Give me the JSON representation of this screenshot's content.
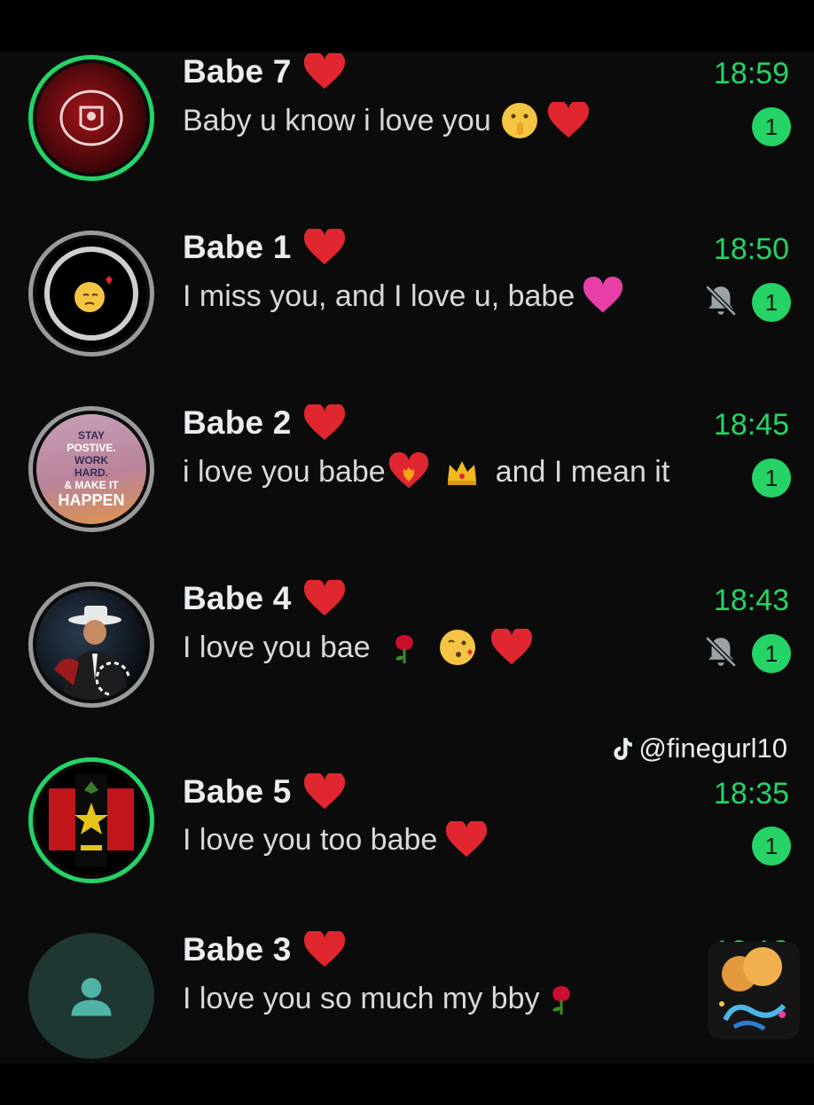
{
  "chats": [
    {
      "name": "Babe 7",
      "time": "18:59",
      "preview": "Baby u know i love you",
      "unread": "1",
      "muted": false
    },
    {
      "name": "Babe 1",
      "time": "18:50",
      "preview": "I miss you, and I love u, babe",
      "unread": "1",
      "muted": true
    },
    {
      "name": "Babe 2",
      "time": "18:45",
      "preview_a": "i love you babe",
      "preview_b": "and I mean it",
      "unread": "1",
      "muted": false,
      "avatar_text": [
        "STAY",
        "POSTIVE.",
        "WORK",
        "HARD.",
        "& MAKE IT",
        "HAPPEN"
      ]
    },
    {
      "name": "Babe 4",
      "time": "18:43",
      "preview": "I love you bae",
      "unread": "1",
      "muted": true
    },
    {
      "name": "Babe 5",
      "time": "18:35",
      "preview": "I love you too babe",
      "unread": "1",
      "muted": false
    },
    {
      "name": "Babe 3",
      "time": "18:18",
      "preview": "I love you so much my bby"
    }
  ],
  "watermark": {
    "handle": "@finegurl10",
    "icon": "tiktok-icon"
  },
  "icons": {
    "heart": "red-heart-icon",
    "mute": "bell-slash-icon",
    "contact": "person-icon"
  },
  "colors": {
    "accent": "#25d366",
    "background": "#0b0b0b",
    "text": "#e9edef",
    "heart": "#e0262f"
  }
}
